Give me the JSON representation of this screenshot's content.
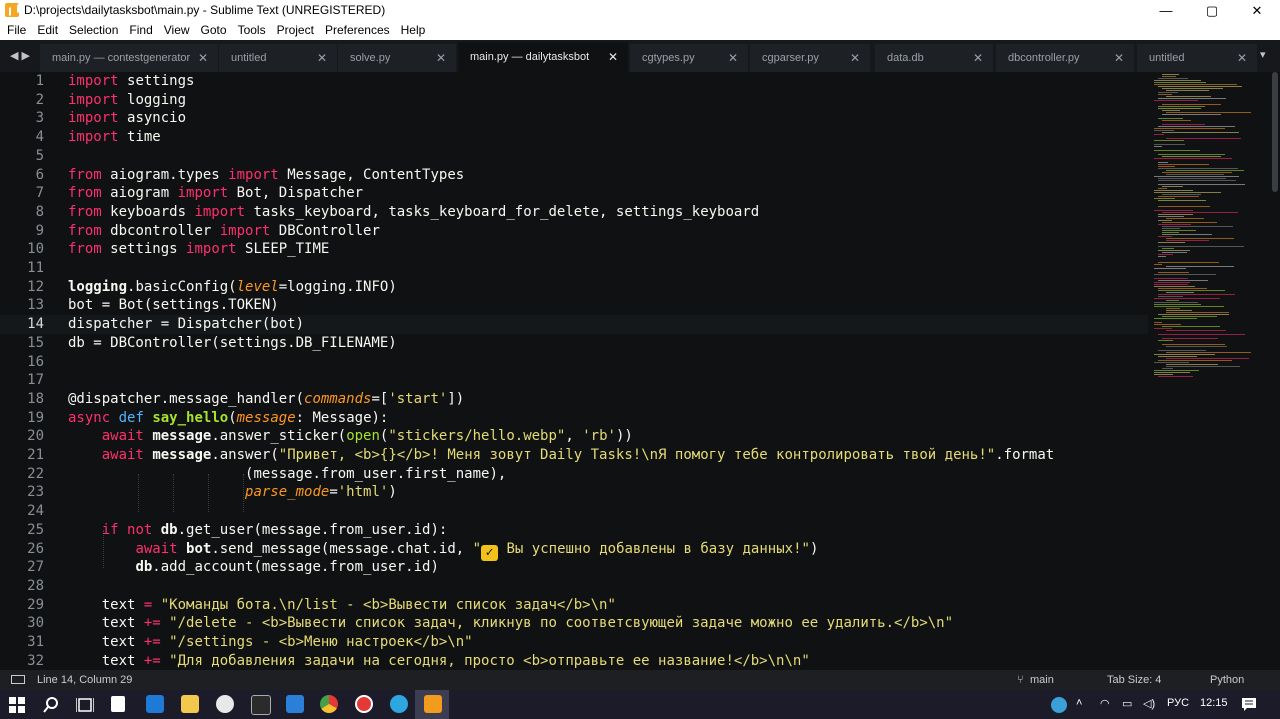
{
  "window": {
    "title": "D:\\projects\\dailytasksbot\\main.py - Sublime Text (UNREGISTERED)",
    "minimize": "—",
    "maximize": "▢",
    "close": "✕"
  },
  "menu": [
    "File",
    "Edit",
    "Selection",
    "Find",
    "View",
    "Goto",
    "Tools",
    "Project",
    "Preferences",
    "Help"
  ],
  "tabnav": "◀ ▶",
  "tabs": [
    {
      "label": "main.py — contestgenerator",
      "active": false
    },
    {
      "label": "untitled",
      "active": false
    },
    {
      "label": "solve.py",
      "active": false
    },
    {
      "label": "main.py — dailytasksbot",
      "active": true
    },
    {
      "label": "cgtypes.py",
      "active": false
    },
    {
      "label": "cgparser.py",
      "active": false
    },
    {
      "label": "data.db",
      "active": false
    },
    {
      "label": "dbcontroller.py",
      "active": false
    },
    {
      "label": "untitled",
      "active": false
    }
  ],
  "tab_close": "✕",
  "current_line": 14,
  "code": [
    {
      "n": "1"
    },
    {
      "n": "2"
    },
    {
      "n": "3"
    },
    {
      "n": "4"
    },
    {
      "n": "5"
    },
    {
      "n": "6"
    },
    {
      "n": "7"
    },
    {
      "n": "8"
    },
    {
      "n": "9"
    },
    {
      "n": "10"
    },
    {
      "n": "11"
    },
    {
      "n": "12"
    },
    {
      "n": "13"
    },
    {
      "n": "14"
    },
    {
      "n": "15"
    },
    {
      "n": "16"
    },
    {
      "n": "17"
    },
    {
      "n": "18"
    },
    {
      "n": "19"
    },
    {
      "n": "20"
    },
    {
      "n": "21"
    },
    {
      "n": "22"
    },
    {
      "n": "23"
    },
    {
      "n": "24"
    },
    {
      "n": "25"
    },
    {
      "n": "26"
    },
    {
      "n": "27"
    },
    {
      "n": "28"
    },
    {
      "n": "29"
    },
    {
      "n": "30"
    },
    {
      "n": "31"
    },
    {
      "n": "32"
    }
  ],
  "tokens": {
    "import": "import",
    "from": "from",
    "async": "async",
    "def": "def",
    "await": "await",
    "if": "if",
    "not": "not",
    "settings": "settings",
    "logging": "logging",
    "asyncio": "asyncio",
    "time": "time",
    "aiogram_types": "aiogram.types",
    "Message_ContentTypes": "Message, ContentTypes",
    "aiogram": "aiogram",
    "Bot_Dispatcher": "Bot, Dispatcher",
    "keyboards": "keyboards",
    "kb_names": "tasks_keyboard, tasks_keyboard_for_delete, settings_keyboard",
    "dbcontroller": "dbcontroller",
    "DBController": "DBController",
    "settings_mod": "settings",
    "SLEEP_TIME": "SLEEP_TIME",
    "l12_a": "logging",
    "l12_b": ".basicConfig(",
    "l12_level": "level",
    "l12_c": "=logging.INFO)",
    "l13": "bot = Bot(settings.TOKEN)",
    "l14": "dispatcher = Dispatcher(bot)",
    "l15": "db = DBController(settings.DB_FILENAME)",
    "l18_a": "@dispatcher.message_handler(",
    "l18_commands": "commands",
    "l18_b": "=[",
    "l18_str": "'start'",
    "l18_c": "])",
    "l19_fn": "say_hello",
    "l19_a": "(",
    "l19_param": "message",
    "l19_b": ": Message):",
    "l20_msg": "message",
    "l20_a": ".answer_sticker(",
    "l20_open": "open",
    "l20_b": "(",
    "l20_s1": "\"stickers/hello.webp\"",
    "l20_c": ", ",
    "l20_s2": "'rb'",
    "l20_d": "))",
    "l21_msg": "message",
    "l21_a": ".answer(",
    "l21_str": "\"Привет, <b>{}</b>! Меня зовут Daily Tasks!\\nЯ помогу тебе контролировать твой день!\"",
    "l21_b": ".format",
    "l22": "(message.from_user.first_name),",
    "l23_param": "parse_mode",
    "l23_a": "=",
    "l23_str": "'html'",
    "l23_b": ")",
    "l25_db": "db",
    "l25_a": ".get_user(message.from_user.id):",
    "l26_bot": "bot",
    "l26_a": ".send_message(message.chat.id, ",
    "l26_q": "\"",
    "l26_check": "✓",
    "l26_str": " Вы успешно добавлены в базу данных!\"",
    "l26_b": ")",
    "l27_db": "db",
    "l27_a": ".add_account(message.from_user.id)",
    "l29_a": "text ",
    "l29_op": "=",
    "l29_str": " \"Команды бота.\\n/list - <b>Вывести список задач</b>\\n\"",
    "l30_a": "text ",
    "l30_op": "+=",
    "l30_str": " \"/delete - <b>Вывести список задач, кликнув по соответсвующей задаче можно ее удалить.</b>\\n\"",
    "l31_a": "text ",
    "l31_op": "+=",
    "l31_str": " \"/settings - <b>Меню настроек</b>\\n\"",
    "l32_a": "text ",
    "l32_op": "+=",
    "l32_str": " \"Для добавления задачи на сегодня, просто <b>отправьте ее название!</b>\\n\\n\""
  },
  "status": {
    "position": "Line 14, Column 29",
    "branch": "main",
    "tab_size": "Tab Size: 4",
    "syntax": "Python"
  },
  "tray": {
    "lang": "РУС",
    "time": "12:15"
  },
  "colors": {
    "keyword": "#ff2f6d",
    "keyword_def": "#4fb4ff",
    "function": "#a6e22e",
    "parameter": "#fd971f",
    "string": "#e6db74",
    "background": "#0f1113"
  }
}
